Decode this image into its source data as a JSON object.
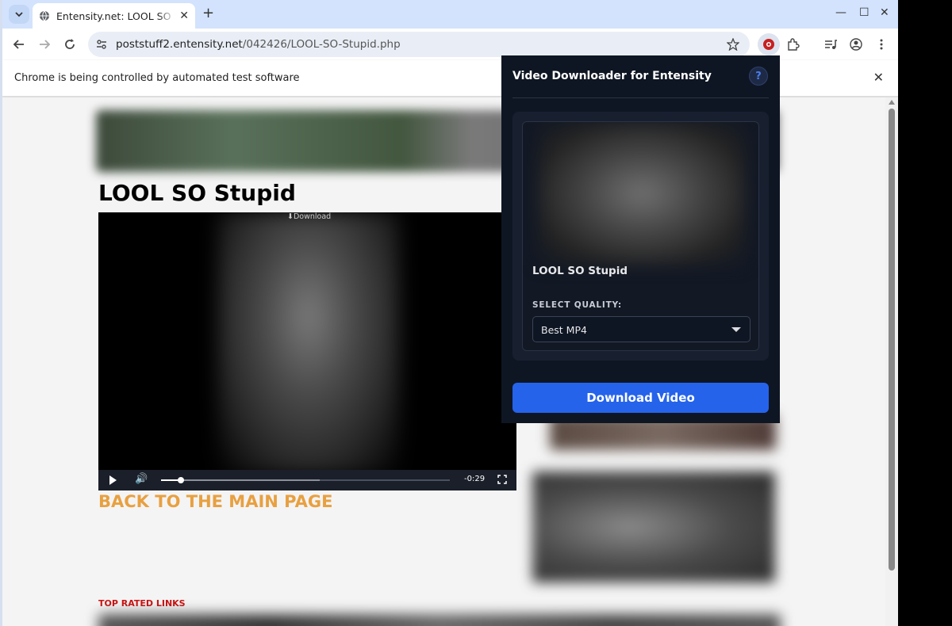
{
  "browser": {
    "tab_title": "Entensity.net: LOOL SO Stupid",
    "url_host": "poststuff2.entensity.net",
    "url_path": "/042426/LOOL-SO-Stupid.php",
    "infobar_message": "Chrome is being controlled by automated test software"
  },
  "page": {
    "title": "LOOL SO Stupid",
    "video_download_link": "⬇Download",
    "video_time": "-0:29",
    "video_progress": 0.07,
    "video_buffered": 0.55,
    "back_link": "BACK TO THE MAIN PAGE",
    "top_rated_heading": "TOP RATED LINKS"
  },
  "popup": {
    "title": "Video Downloader for Entensity",
    "help_label": "?",
    "video_title": "LOOL SO Stupid",
    "quality_label": "SELECT QUALITY:",
    "quality_value": "Best MP4",
    "download_button": "Download Video"
  },
  "colors": {
    "accent": "#2563eb",
    "popup_bg": "#0f1623",
    "back_link": "#e8a040",
    "top_rated": "#cc1111"
  }
}
